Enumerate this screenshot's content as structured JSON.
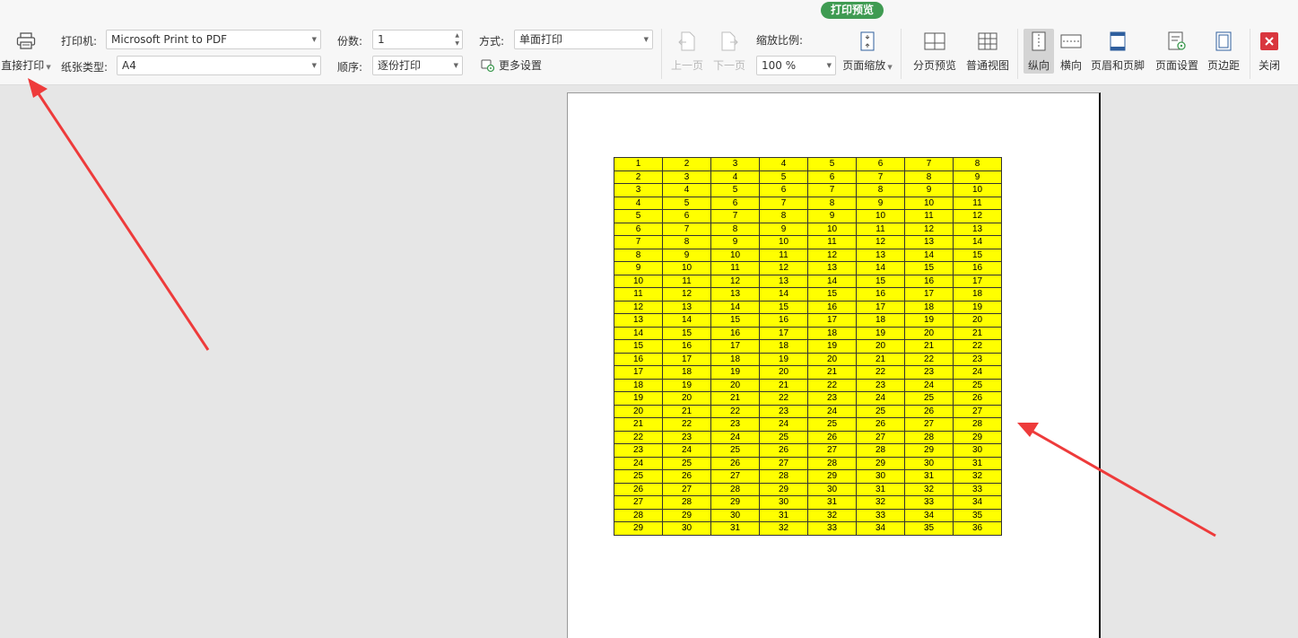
{
  "ribbon": {
    "tab_badge": "打印预览",
    "direct_print": "直接打印",
    "printer_label": "打印机:",
    "printer_value": "Microsoft Print to PDF",
    "paper_label": "纸张类型:",
    "paper_value": "A4",
    "copies_label": "份数:",
    "copies_value": "1",
    "order_label": "顺序:",
    "order_value": "逐份打印",
    "mode_label": "方式:",
    "mode_value": "单面打印",
    "more_settings": "更多设置",
    "prev_page": "上一页",
    "next_page": "下一页",
    "zoom_label": "缩放比例:",
    "zoom_value": "100 %",
    "page_zoom": "页面缩放",
    "page_break_preview": "分页预览",
    "normal_view": "普通视图",
    "portrait": "纵向",
    "landscape": "横向",
    "header_footer": "页眉和页脚",
    "page_setup": "页面设置",
    "margins": "页边距",
    "close": "关闭"
  },
  "table": {
    "start_values": [
      1,
      2,
      3,
      4,
      5,
      6,
      7,
      8,
      9,
      10,
      11,
      12,
      13,
      14,
      15,
      16,
      17,
      18,
      19,
      20,
      21,
      22,
      23,
      24,
      25,
      26,
      27,
      28,
      29
    ],
    "columns": 8,
    "fill_color": "#ffff00"
  },
  "colors": {
    "accent_green": "#3f9b52",
    "close_red": "#d9363e",
    "arrow_red": "#ee3b3b"
  }
}
